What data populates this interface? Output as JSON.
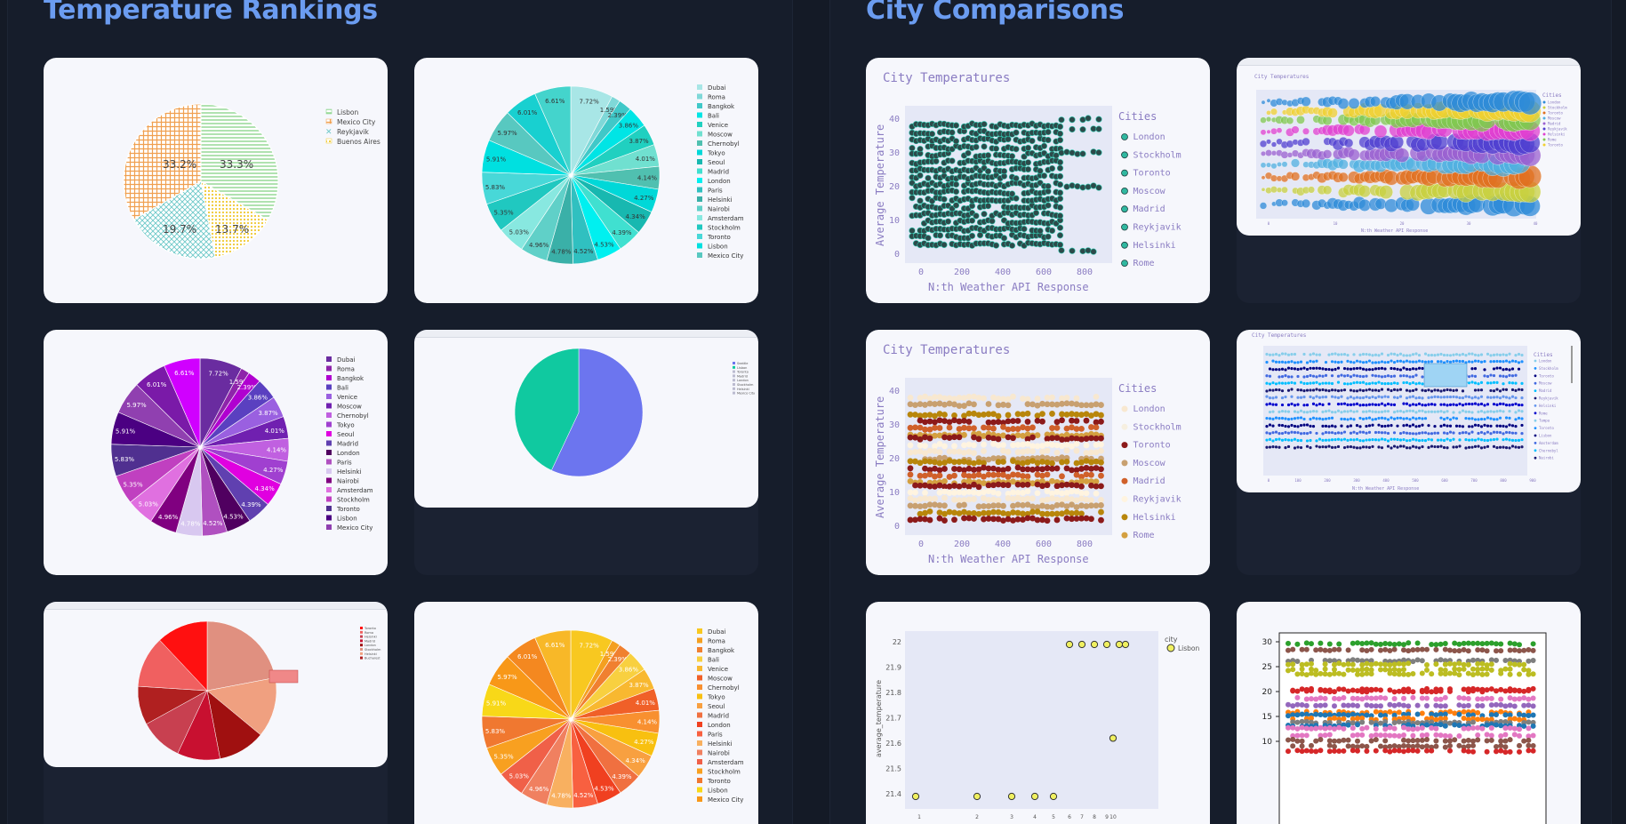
{
  "left_title": "Temperature Rankings",
  "right_title": "City Comparisons",
  "colors": {
    "background": "#141a26",
    "title": "#6b9cf0",
    "card": "#f6f7fc"
  },
  "pie_patterned": {
    "legend": [
      "Lisbon",
      "Mexico City",
      "Reykjavik",
      "Buenos Aires"
    ],
    "slices": [
      {
        "label": "33.3%",
        "value": 33.3
      },
      {
        "label": "33.2%",
        "value": 33.2
      },
      {
        "label": "19.7%",
        "value": 19.7
      },
      {
        "label": "13.7%",
        "value": 13.7
      }
    ]
  },
  "pie_cities": {
    "legend": [
      "Dubai",
      "Roma",
      "Bangkok",
      "Bali",
      "Venice",
      "Moscow",
      "Chernobyl",
      "Tokyo",
      "Seoul",
      "Madrid",
      "London",
      "Paris",
      "Helsinki",
      "Nairobi",
      "Amsterdam",
      "Stockholm",
      "Toronto",
      "Lisbon",
      "Mexico City"
    ],
    "percents": [
      "7.72%",
      "1.59%",
      "2.39%",
      "3.86%",
      "3.87%",
      "4.01%",
      "4.14%",
      "4.27%",
      "4.34%",
      "4.39%",
      "4.53%",
      "4.52%",
      "4.78%",
      "4.96%",
      "5.03%",
      "5.35%",
      "5.83%",
      "5.91%",
      "5.97%",
      "6.01%",
      "6.61%"
    ]
  },
  "pie_small": {
    "legend": [
      "Seattle",
      "Lisbon",
      "Toronto",
      "Madrid",
      "London",
      "Stockholm",
      "Helsinki",
      "Mexico City"
    ]
  },
  "pie_red": {
    "legend": [
      "Toronto",
      "Roma",
      "Helsinki",
      "Madrid",
      "London",
      "Stockholm",
      "Helsinki",
      "Bucharest"
    ]
  },
  "scatter_teal": {
    "title": "City Temperatures",
    "xlabel": "N:th Weather API Response",
    "ylabel": "Average Temperature",
    "legend_title": "Cities",
    "legend": [
      "London",
      "Stockholm",
      "Toronto",
      "Moscow",
      "Madrid",
      "Reykjavik",
      "Helsinki",
      "Rome"
    ],
    "xticks": [
      "0",
      "200",
      "400",
      "600",
      "800"
    ],
    "yticks": [
      "0",
      "10",
      "20",
      "30",
      "40"
    ]
  },
  "bubble": {
    "title": "City Temperatures",
    "xlabel": "N:th Weather API Response",
    "ylabel": "Average Temperature",
    "legend_title": "Cities",
    "legend": [
      "London",
      "Stockholm",
      "Toronto",
      "Moscow",
      "Madrid",
      "Reykjavik",
      "Helsinki",
      "Rome",
      "Toronto"
    ],
    "xticks": [
      "0",
      "10",
      "20",
      "30",
      "40"
    ]
  },
  "scatter_earth": {
    "title": "City Temperatures",
    "xlabel": "N:th Weather API Response",
    "ylabel": "Average Temperature",
    "legend_title": "Cities",
    "legend": [
      "London",
      "Stockholm",
      "Toronto",
      "Moscow",
      "Madrid",
      "Reykjavik",
      "Helsinki",
      "Rome"
    ],
    "xticks": [
      "0",
      "200",
      "400",
      "600",
      "800"
    ],
    "yticks": [
      "0",
      "10",
      "20",
      "30",
      "40"
    ]
  },
  "scatter_blue": {
    "title": "City Temperatures",
    "xlabel": "N:th Weather API Response",
    "ylabel": "Average Temperature",
    "legend_title": "Cities",
    "legend": [
      "London",
      "Stockholm",
      "Toronto",
      "Moscow",
      "Madrid",
      "Reykjavik",
      "Helsinki",
      "Rome",
      "Tampa",
      "Toronto",
      "Lisbon",
      "Amsterdam",
      "Chernobyl",
      "Nairobi"
    ],
    "xticks": [
      "0",
      "100",
      "200",
      "300",
      "400",
      "500",
      "600",
      "700",
      "800",
      "900"
    ]
  },
  "scatter_lisbon": {
    "legend_title": "city",
    "legend": [
      "Lisbon"
    ],
    "ylabel": "average_temperature",
    "yticks": [
      "22",
      "21.9",
      "21.8",
      "21.7",
      "21.6",
      "21.5",
      "21.4"
    ],
    "xticks": [
      "1",
      "2",
      "3",
      "4",
      "5",
      "6",
      "7",
      "8",
      "9",
      "10"
    ]
  },
  "scatter_mpl": {
    "yticks": [
      "30",
      "25",
      "20",
      "15",
      "10"
    ]
  },
  "chart_data": [
    {
      "type": "pie",
      "labels": [
        "Lisbon",
        "Mexico City",
        "Reykjavik",
        "Buenos Aires"
      ],
      "values": [
        33.3,
        33.2,
        19.7,
        13.7
      ]
    },
    {
      "type": "pie",
      "labels": [
        "Dubai",
        "Roma",
        "Bangkok",
        "Bali",
        "Venice",
        "Moscow",
        "Chernobyl",
        "Tokyo",
        "Seoul",
        "Madrid",
        "London",
        "Paris",
        "Helsinki",
        "Nairobi",
        "Amsterdam",
        "Stockholm",
        "Toronto",
        "Lisbon",
        "Mexico City"
      ],
      "values": [
        7.72,
        1.59,
        2.39,
        3.86,
        3.87,
        4.01,
        4.14,
        4.27,
        4.34,
        4.39,
        4.53,
        4.52,
        4.78,
        4.96,
        5.03,
        5.35,
        5.83,
        5.91,
        5.97,
        6.01,
        6.61
      ]
    },
    {
      "type": "scatter",
      "title": "City Temperatures",
      "xlabel": "N:th Weather API Response",
      "ylabel": "Average Temperature",
      "xlim": [
        0,
        900
      ],
      "ylim": [
        0,
        45
      ]
    },
    {
      "type": "scatter",
      "ylabel": "average_temperature",
      "x": [
        1,
        2,
        3,
        4,
        5,
        6,
        7,
        8,
        9,
        10
      ],
      "series": [
        {
          "name": "Lisbon",
          "values": [
            21.4,
            21.4,
            21.4,
            21.4,
            21.4,
            22.0,
            22.0,
            22.0,
            22.0,
            21.63
          ]
        }
      ]
    }
  ]
}
